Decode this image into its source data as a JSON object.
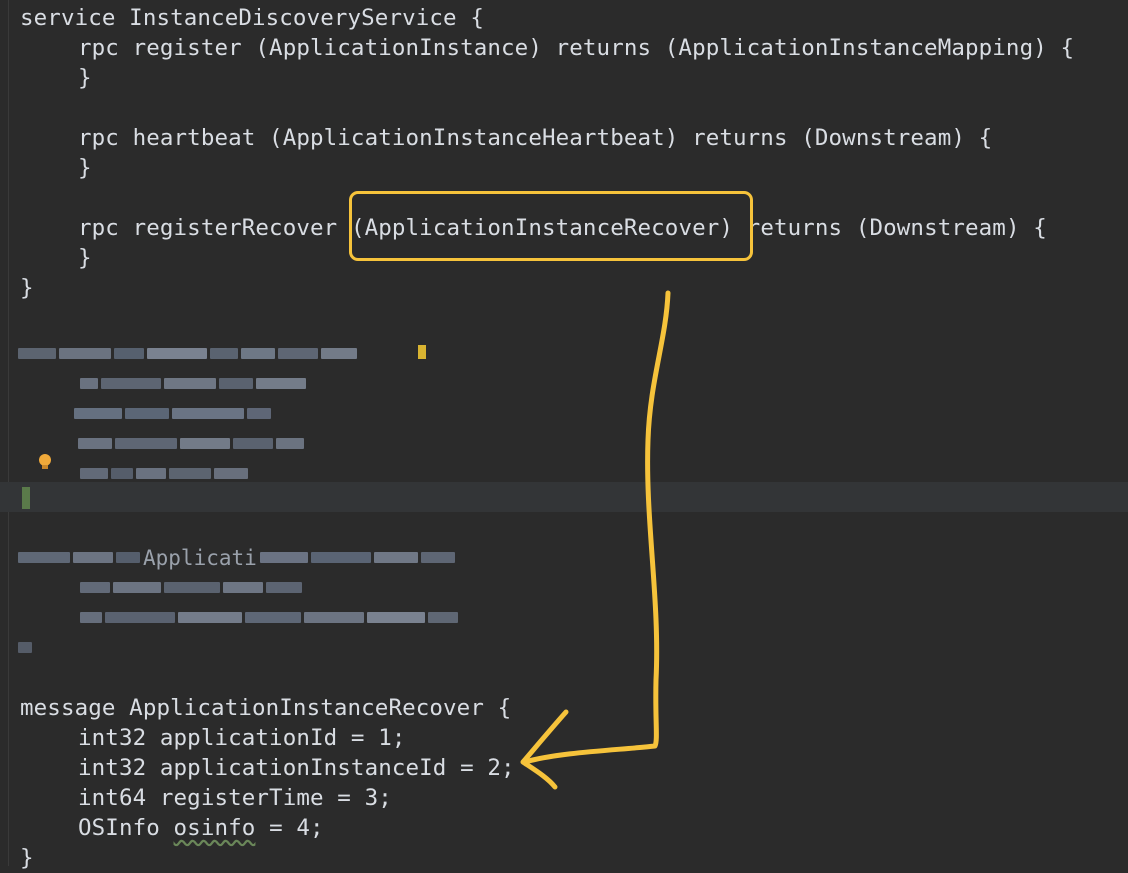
{
  "code": {
    "service_decl": "service InstanceDiscoveryService {",
    "rpc_register": "rpc register (ApplicationInstance) returns (ApplicationInstanceMapping) {",
    "close_brace_1": "}",
    "rpc_heartbeat": "rpc heartbeat (ApplicationInstanceHeartbeat) returns (Downstream) {",
    "close_brace_2": "}",
    "rpc_recover_keyword": "rpc registerRecover ",
    "rpc_recover_param": "(ApplicationInstanceRecover)",
    "rpc_recover_rest": " returns (Downstream) {",
    "close_brace_3": "}",
    "service_close": "}",
    "blurred_partial": "Applicati",
    "message_decl": "message ApplicationInstanceRecover {",
    "field_1": "int32 applicationId = 1;",
    "field_2": "int32 applicationInstanceId = 2;",
    "field_3": "int64 registerTime = 3;",
    "field_4_type": "OSInfo ",
    "field_4_name": "osinfo",
    "field_4_rest": " = 4;",
    "message_close": "}"
  },
  "colors": {
    "background": "#2b2b2b",
    "text": "#d9dde3",
    "annotation": "#f6c33b"
  },
  "icons": {
    "bulb": "lightbulb-icon",
    "arrow": "annotation-arrow"
  }
}
